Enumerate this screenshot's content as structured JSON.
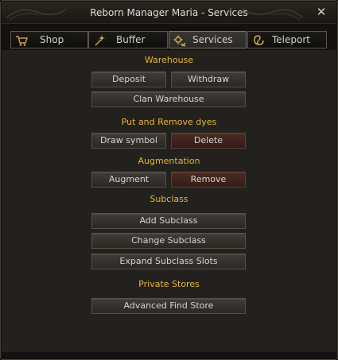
{
  "window": {
    "title": "Reborn Manager Maria - Services"
  },
  "tabs": [
    {
      "label": "Shop",
      "icon": "cart-icon"
    },
    {
      "label": "Buffer",
      "icon": "sparkle-wand-icon"
    },
    {
      "label": "Services",
      "icon": "gears-icon",
      "active": true
    },
    {
      "label": "Teleport",
      "icon": "swirl-icon"
    }
  ],
  "sections": {
    "warehouse": {
      "heading": "Warehouse",
      "deposit": "Deposit",
      "withdraw": "Withdraw",
      "clan_warehouse": "Clan Warehouse"
    },
    "dyes": {
      "heading": "Put and Remove dyes",
      "draw_symbol": "Draw symbol",
      "delete": "Delete"
    },
    "augmentation": {
      "heading": "Augmentation",
      "augment": "Augment",
      "remove": "Remove"
    },
    "subclass": {
      "heading": "Subclass",
      "add": "Add Subclass",
      "change": "Change Subclass",
      "expand": "Expand Subclass Slots"
    },
    "private_stores": {
      "heading": "Private Stores",
      "advanced_find": "Advanced Find Store"
    }
  },
  "colors": {
    "heading_gold": "#e6b53c",
    "button_gray": "#3a3631",
    "button_red": "#3f221c"
  }
}
